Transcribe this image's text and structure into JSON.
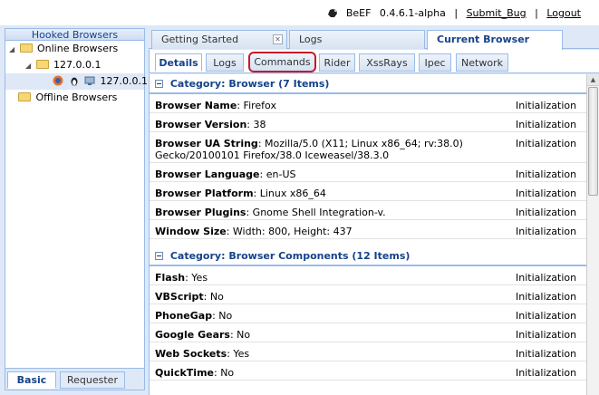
{
  "header": {
    "app_name": "BeEF",
    "version": "0.4.6.1-alpha",
    "submit_bug": "Submit_Bug",
    "logout": "Logout"
  },
  "left_panel": {
    "title": "Hooked Browsers",
    "online": "Online Browsers",
    "host": "127.0.0.1",
    "browser_ip": "127.0.0.1",
    "offline": "Offline Browsers",
    "tabs": [
      "Basic",
      "Requester"
    ]
  },
  "top_tabs": [
    "Getting Started",
    "Logs",
    "Current Browser"
  ],
  "sub_tabs": [
    "Details",
    "Logs",
    "Commands",
    "Rider",
    "XssRays",
    "Ipec",
    "Network"
  ],
  "categories": [
    {
      "title": "Category: Browser (7 Items)",
      "rows": [
        {
          "key": "Browser Name",
          "value": ": Firefox",
          "source": "Initialization"
        },
        {
          "key": "Browser Version",
          "value": ": 38",
          "source": "Initialization"
        },
        {
          "key": "Browser UA String",
          "value": ": Mozilla/5.0 (X11; Linux x86_64; rv:38.0) Gecko/20100101 Firefox/38.0 Iceweasel/38.3.0",
          "source": "Initialization"
        },
        {
          "key": "Browser Language",
          "value": ": en-US",
          "source": "Initialization"
        },
        {
          "key": "Browser Platform",
          "value": ": Linux x86_64",
          "source": "Initialization"
        },
        {
          "key": "Browser Plugins",
          "value": ": Gnome Shell Integration-v.",
          "source": "Initialization"
        },
        {
          "key": "Window Size",
          "value": ": Width: 800, Height: 437",
          "source": "Initialization"
        }
      ]
    },
    {
      "title": "Category: Browser Components (12 Items)",
      "rows": [
        {
          "key": "Flash",
          "value": ": Yes",
          "source": "Initialization"
        },
        {
          "key": "VBScript",
          "value": ": No",
          "source": "Initialization"
        },
        {
          "key": "PhoneGap",
          "value": ": No",
          "source": "Initialization"
        },
        {
          "key": "Google Gears",
          "value": ": No",
          "source": "Initialization"
        },
        {
          "key": "Web Sockets",
          "value": ": Yes",
          "source": "Initialization"
        },
        {
          "key": "QuickTime",
          "value": ": No",
          "source": "Initialization"
        }
      ]
    }
  ],
  "colors": {
    "accent": "#15428b",
    "border": "#99bbe8",
    "highlight": "#c8192a"
  }
}
